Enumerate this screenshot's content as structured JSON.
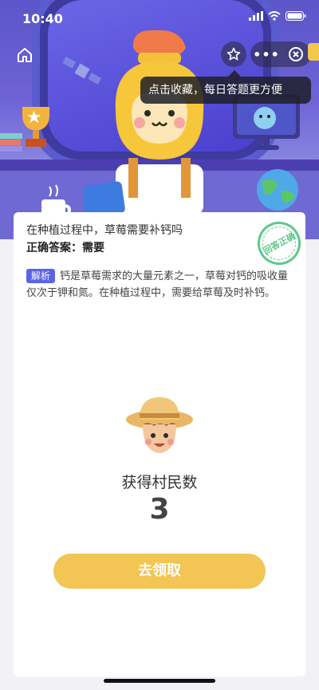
{
  "status_bar": {
    "time": "10:40"
  },
  "top_bar": {
    "tooltip": "点击收藏，每日答题更方便",
    "more_label": "•••"
  },
  "quiz": {
    "question": "在种植过程中，草莓需要补钙吗",
    "answer_prefix": "正确答案：",
    "answer_value": "需要",
    "stamp_text": "回答正确",
    "explain_tag": "解析",
    "explanation": "钙是草莓需求的大量元素之一，草莓对钙的吸收量仅次于钾和氮。在种植过程中，需要给草莓及时补钙。"
  },
  "reward": {
    "label": "获得村民数",
    "count": "3",
    "button_label": "去领取"
  },
  "colors": {
    "accent": "#f2c554",
    "tag": "#5b63e6",
    "stamp": "#5cc98a",
    "hero": "#5b56c9"
  },
  "icons": [
    "home-icon",
    "star-icon",
    "close-icon",
    "signal-icon",
    "wifi-icon",
    "battery-icon"
  ]
}
